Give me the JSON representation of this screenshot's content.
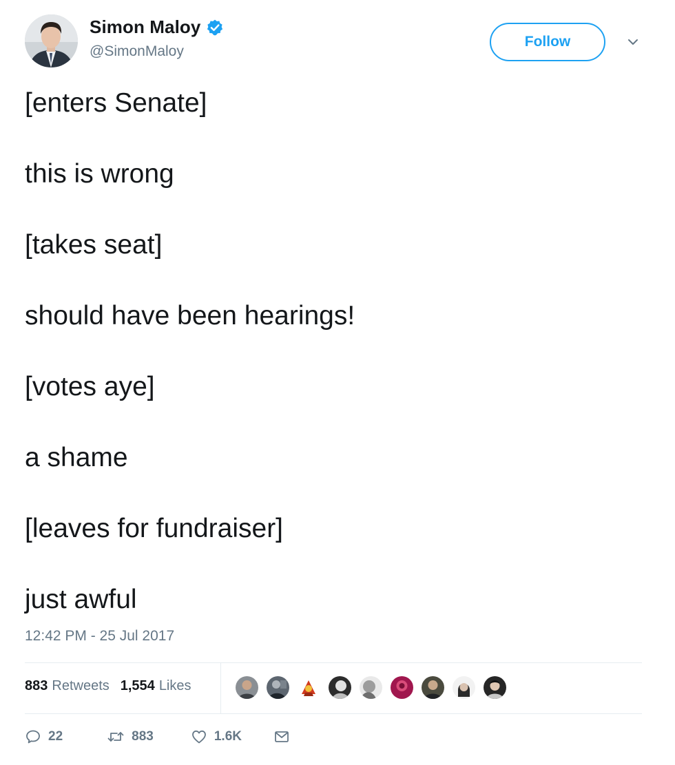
{
  "author": {
    "display_name": "Simon Maloy",
    "handle": "@SimonMaloy",
    "verified": true
  },
  "follow_label": "Follow",
  "tweet": {
    "lines": [
      "[enters Senate]",
      "this is wrong",
      "[takes seat]",
      "should have been hearings!",
      "[votes aye]",
      "a shame",
      "[leaves for fundraiser]",
      "just awful"
    ],
    "timestamp": "12:42 PM - 25 Jul 2017"
  },
  "stats": {
    "retweets_count": "883",
    "retweets_label": "Retweets",
    "likes_count": "1,554",
    "likes_label": "Likes"
  },
  "liker_avatars": 9,
  "actions": {
    "replies": "22",
    "retweets": "883",
    "likes": "1.6K"
  },
  "colors": {
    "accent": "#1da1f2",
    "secondary_text": "#657786",
    "primary_text": "#14171a",
    "divider": "#e6ecf0"
  }
}
